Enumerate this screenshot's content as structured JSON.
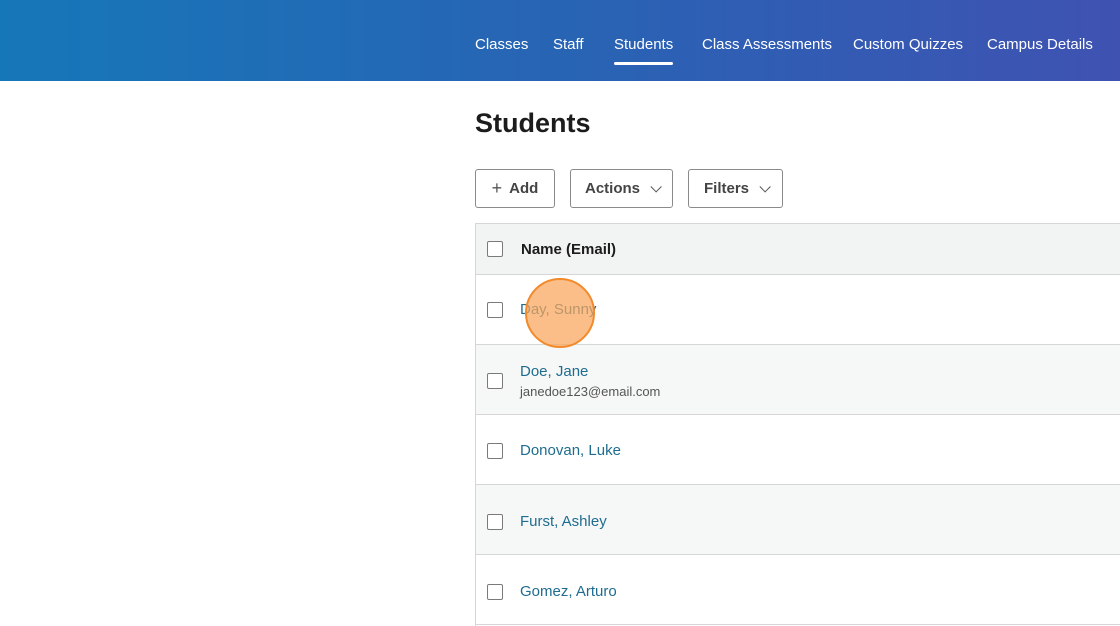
{
  "nav": {
    "items": [
      {
        "label": "Classes",
        "active": false
      },
      {
        "label": "Staff",
        "active": false
      },
      {
        "label": "Students",
        "active": true
      },
      {
        "label": "Class Assessments",
        "active": false
      },
      {
        "label": "Custom Quizzes",
        "active": false
      },
      {
        "label": "Campus Details",
        "active": false
      }
    ]
  },
  "page": {
    "title": "Students"
  },
  "toolbar": {
    "add_label": "Add",
    "add_icon": "plus-icon",
    "actions_label": "Actions",
    "filters_label": "Filters",
    "dropdown_icon": "chevron-down-icon"
  },
  "table": {
    "header": {
      "name_email": "Name (Email)"
    },
    "rows": [
      {
        "name": "Day, Sunny",
        "email": ""
      },
      {
        "name": "Doe, Jane",
        "email": "janedoe123@email.com"
      },
      {
        "name": "Donovan, Luke",
        "email": ""
      },
      {
        "name": "Furst, Ashley",
        "email": ""
      },
      {
        "name": "Gomez, Arturo",
        "email": ""
      }
    ]
  },
  "colors": {
    "header_gradient_start": "#1677b8",
    "header_gradient_end": "#3f52b2",
    "link": "#1f6c8f",
    "cursor_highlight": "#f28a2c"
  }
}
